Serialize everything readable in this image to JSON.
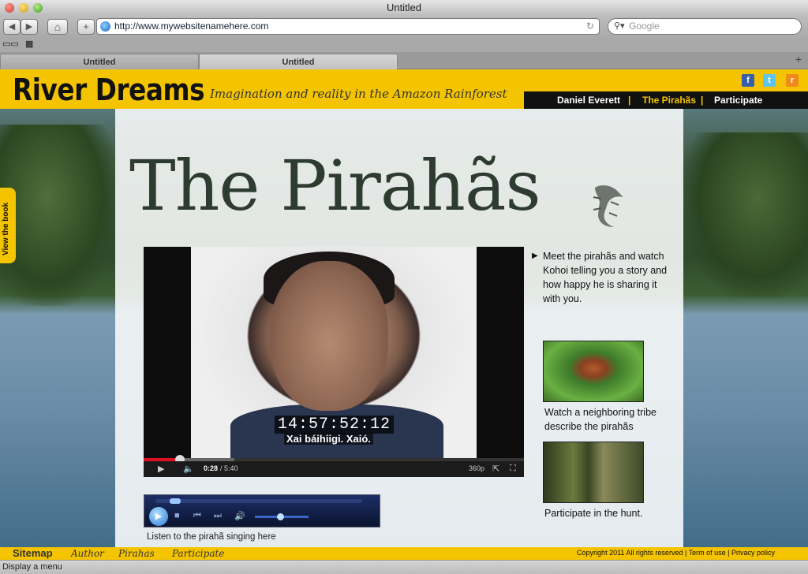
{
  "window": {
    "title": "Untitled"
  },
  "toolbar": {
    "back_label": "◀",
    "forward_label": "▶",
    "home_label": "⌂",
    "add_label": "+",
    "url": "http://www.mywebsitenamehere.com",
    "search_placeholder": "Google"
  },
  "tabs": [
    {
      "label": "Untitled"
    },
    {
      "label": "Untitled"
    }
  ],
  "site": {
    "logo": "River Dreams",
    "tagline": "Imagination and reality in the Amazon Rainforest",
    "nav": [
      {
        "label": "Daniel Everett"
      },
      {
        "label": "The Pirahãs"
      },
      {
        "label": "Participate"
      }
    ],
    "nav_sep": "|",
    "social": {
      "facebook": "f",
      "twitter": "t",
      "rss": "r"
    },
    "book_tab": "View the book",
    "page_title": "The Pirahãs",
    "video": {
      "timecode": "14:57:52:12",
      "subtitle": "Xai báihiigi. Xaió.",
      "time_current": "0:28",
      "time_total": "/ 5:40",
      "quality": "360p",
      "progress_fraction": 0.095
    },
    "intro_text": "Meet the pirahãs and watch Kohoi telling you a story and how happy he is sharing it with you.",
    "thumbs": [
      {
        "caption": "Watch a neighboring tribe describe the pirahãs"
      },
      {
        "caption": "Participate in the hunt."
      }
    ],
    "audio_caption": "Listen to the pirahã singing here",
    "footer": {
      "sitemap": "Sitemap",
      "links": [
        {
          "label": "Author"
        },
        {
          "label": "Pirahas"
        },
        {
          "label": "Participate"
        }
      ],
      "copyright": "Copyright 2011 All rights reserved | Term of use | Privacy policy"
    }
  },
  "status": {
    "text": "Display a menu"
  }
}
